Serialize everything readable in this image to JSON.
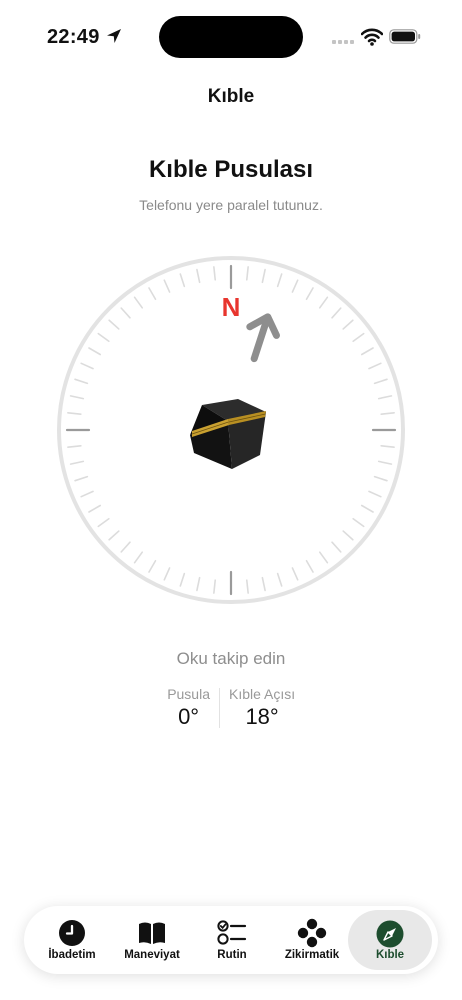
{
  "status_bar": {
    "time": "22:49"
  },
  "nav": {
    "title": "Kıble"
  },
  "main": {
    "title": "Kıble Pusulası",
    "subtitle": "Telefonu yere paralel tutunuz.",
    "compass": {
      "north_label": "N",
      "north_color": "#e8352e",
      "arrow_color": "#8e8e8e",
      "qibla_angle_deg": 18,
      "heading_deg": 0
    },
    "instruction": "Oku takip edin",
    "stats": {
      "compass_label": "Pusula",
      "compass_value": "0°",
      "qibla_label": "Kıble Açısı",
      "qibla_value": "18°"
    }
  },
  "tabbar": {
    "active_color": "#1d4d2e",
    "items": [
      {
        "label": "İbadetim",
        "icon": "clock-icon"
      },
      {
        "label": "Maneviyat",
        "icon": "book-icon"
      },
      {
        "label": "Rutin",
        "icon": "checklist-icon"
      },
      {
        "label": "Zikirmatik",
        "icon": "dots-icon"
      },
      {
        "label": "Kıble",
        "icon": "compass-icon"
      }
    ]
  }
}
